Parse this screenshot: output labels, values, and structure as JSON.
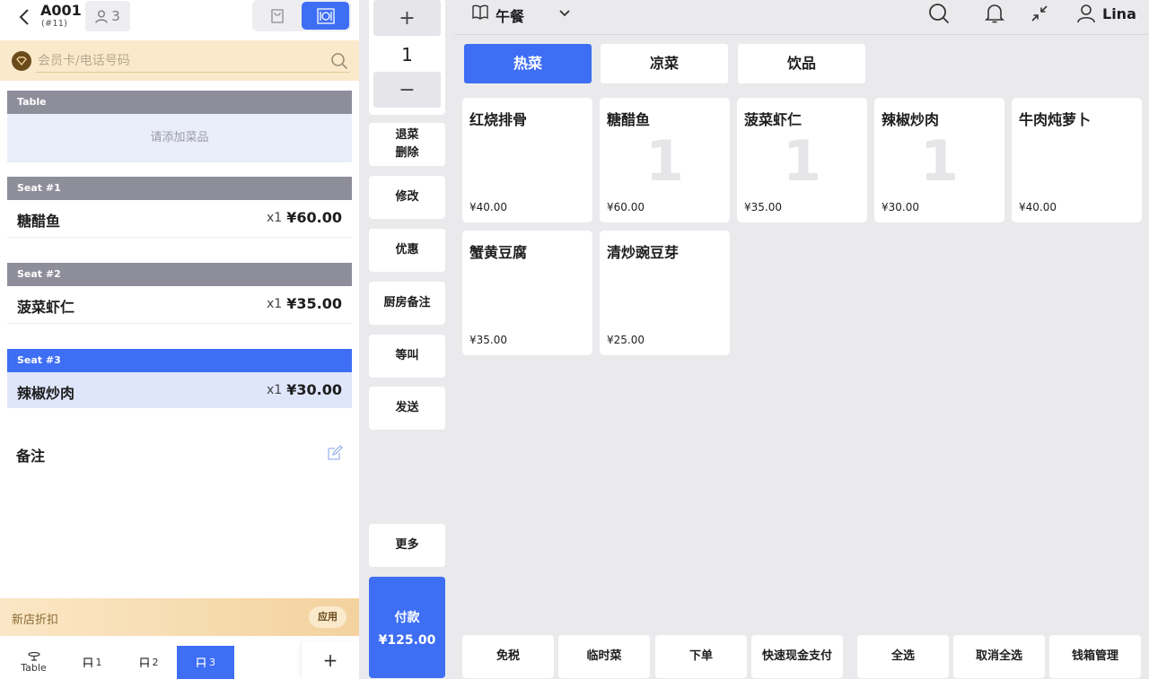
{
  "order": {
    "number": "A001",
    "sub": "(#11)",
    "guests": "3"
  },
  "member": {
    "placeholder": "会员卡/电话号码"
  },
  "sections": {
    "table": {
      "label": "Table",
      "empty_text": "请添加菜品"
    },
    "seat1": {
      "label": "Seat #1",
      "item": {
        "name": "糖醋鱼",
        "qty": "x1",
        "price": "¥60.00"
      }
    },
    "seat2": {
      "label": "Seat #2",
      "item": {
        "name": "菠菜虾仁",
        "qty": "x1",
        "price": "¥35.00"
      }
    },
    "seat3": {
      "label": "Seat #3",
      "item": {
        "name": "辣椒炒肉",
        "qty": "x1",
        "price": "¥30.00"
      }
    }
  },
  "notes_label": "备注",
  "promo": {
    "label": "新店折扣",
    "button": "应用"
  },
  "seat_tabs": {
    "table": "Table",
    "s1": "1",
    "s2": "2",
    "s3": "3",
    "add": "+"
  },
  "stepper": {
    "plus": "+",
    "value": "1",
    "minus": "−"
  },
  "actions": {
    "void_line1": "退菜",
    "void_line2": "删除",
    "modify": "修改",
    "discount": "优惠",
    "kitchen_note": "厨房备注",
    "hold": "等叫",
    "send": "发送",
    "more": "更多",
    "pay_label": "付款",
    "pay_amount": "¥125.00"
  },
  "topbar": {
    "menu_name": "午餐",
    "username": "Lina"
  },
  "categories": [
    "热菜",
    "凉菜",
    "饮品"
  ],
  "dishes": [
    {
      "name": "红烧排骨",
      "price": "¥40.00",
      "count": ""
    },
    {
      "name": "糖醋鱼",
      "price": "¥60.00",
      "count": "1"
    },
    {
      "name": "菠菜虾仁",
      "price": "¥35.00",
      "count": "1"
    },
    {
      "name": "辣椒炒肉",
      "price": "¥30.00",
      "count": "1"
    },
    {
      "name": "牛肉炖萝卜",
      "price": "¥40.00",
      "count": ""
    },
    {
      "name": "蟹黄豆腐",
      "price": "¥35.00",
      "count": ""
    },
    {
      "name": "清炒豌豆芽",
      "price": "¥25.00",
      "count": ""
    }
  ],
  "bottom_actions": [
    "免税",
    "临时菜",
    "下单",
    "快速现金支付",
    "全选",
    "取消全选",
    "钱箱管理"
  ],
  "colors": {
    "accent": "#3d6ef4",
    "section_header": "#8e8d9a",
    "member_bg": "#fbe9cb"
  }
}
